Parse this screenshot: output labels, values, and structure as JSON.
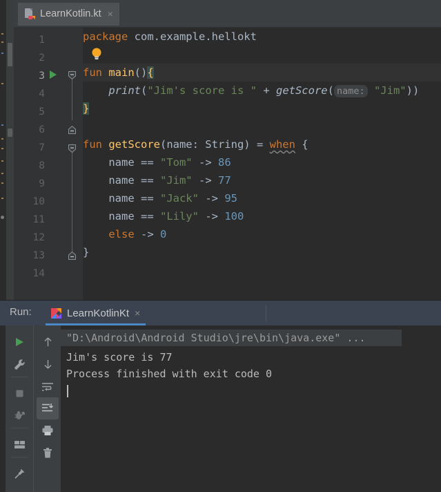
{
  "window": {
    "title": "LearnKotlin.kt",
    "theme": "darcula"
  },
  "colors": {
    "editor_bg": "#2b2b2b",
    "gutter_bg": "#313335",
    "tabbar_bg": "#3c3f41",
    "tab_active_bg": "#4e5254",
    "run_header_bg": "#3c4350",
    "run_tab_underline": "#4a88c7",
    "toolbar_bg": "#3c3f41",
    "keyword": "#cc7832",
    "function_name": "#ffc66d",
    "string": "#6a8759",
    "number": "#6897bb",
    "plain_text": "#a9b7c6",
    "line_number": "#606366",
    "run_arrow_green": "#499c54",
    "console_text": "#bbbbbb",
    "inlay_hint_bg": "#3d4144",
    "brace_match_bg": "#3b514d"
  },
  "editor_tabs": [
    {
      "label": "LearnKotlin.kt",
      "icon": "kotlin-file-icon",
      "close": "×",
      "active": true
    }
  ],
  "gutter": {
    "line_numbers": [
      "1",
      "2",
      "3",
      "4",
      "5",
      "6",
      "7",
      "8",
      "9",
      "10",
      "11",
      "12",
      "13",
      "14"
    ],
    "current_line": 3,
    "run_marker_line": 3,
    "bulb_line": 2,
    "fold_markers": [
      {
        "line": 3,
        "type": "fold-open"
      },
      {
        "line": 5,
        "type": "fold-end"
      },
      {
        "line": 7,
        "type": "fold-open"
      },
      {
        "line": 13,
        "type": "fold-end"
      }
    ]
  },
  "code": {
    "lines": [
      {
        "n": 1,
        "tokens": [
          {
            "t": "package ",
            "c": "kw"
          },
          {
            "t": "com.example.hellokt",
            "c": "pln"
          }
        ]
      },
      {
        "n": 2,
        "tokens": []
      },
      {
        "n": 3,
        "tokens": [
          {
            "t": "fun ",
            "c": "kw"
          },
          {
            "t": "main",
            "c": "fnm"
          },
          {
            "t": "()",
            "c": "pln"
          },
          {
            "t": "{",
            "c": "brace-hl"
          }
        ]
      },
      {
        "n": 4,
        "tokens": [
          {
            "t": "    ",
            "c": "pln"
          },
          {
            "t": "print",
            "c": "ital"
          },
          {
            "t": "(",
            "c": "pln"
          },
          {
            "t": "\"Jim's score is \"",
            "c": "str"
          },
          {
            "t": " + ",
            "c": "pln"
          },
          {
            "t": "getScore",
            "c": "ital"
          },
          {
            "t": "(",
            "c": "pln"
          },
          {
            "t": "name:",
            "c": "hint"
          },
          {
            "t": " ",
            "c": "pln"
          },
          {
            "t": "\"Jim\"",
            "c": "str"
          },
          {
            "t": "))",
            "c": "pln"
          }
        ]
      },
      {
        "n": 5,
        "tokens": [
          {
            "t": "}",
            "c": "brace-hl"
          }
        ]
      },
      {
        "n": 6,
        "tokens": []
      },
      {
        "n": 7,
        "tokens": [
          {
            "t": "fun ",
            "c": "kw"
          },
          {
            "t": "getScore",
            "c": "fnm"
          },
          {
            "t": "(name: String) = ",
            "c": "pln"
          },
          {
            "t": "when",
            "c": "kw wavy"
          },
          {
            "t": " {",
            "c": "pln"
          }
        ]
      },
      {
        "n": 8,
        "tokens": [
          {
            "t": "    name == ",
            "c": "pln"
          },
          {
            "t": "\"Tom\"",
            "c": "str"
          },
          {
            "t": " -> ",
            "c": "pln"
          },
          {
            "t": "86",
            "c": "num"
          }
        ]
      },
      {
        "n": 9,
        "tokens": [
          {
            "t": "    name == ",
            "c": "pln"
          },
          {
            "t": "\"Jim\"",
            "c": "str"
          },
          {
            "t": " -> ",
            "c": "pln"
          },
          {
            "t": "77",
            "c": "num"
          }
        ]
      },
      {
        "n": 10,
        "tokens": [
          {
            "t": "    name == ",
            "c": "pln"
          },
          {
            "t": "\"Jack\"",
            "c": "str"
          },
          {
            "t": " -> ",
            "c": "pln"
          },
          {
            "t": "95",
            "c": "num"
          }
        ]
      },
      {
        "n": 11,
        "tokens": [
          {
            "t": "    name == ",
            "c": "pln"
          },
          {
            "t": "\"Lily\"",
            "c": "str"
          },
          {
            "t": " -> ",
            "c": "pln"
          },
          {
            "t": "100",
            "c": "num"
          }
        ]
      },
      {
        "n": 12,
        "tokens": [
          {
            "t": "    ",
            "c": "pln"
          },
          {
            "t": "else",
            "c": "kw"
          },
          {
            "t": " -> ",
            "c": "pln"
          },
          {
            "t": "0",
            "c": "num"
          }
        ]
      },
      {
        "n": 13,
        "tokens": [
          {
            "t": "}",
            "c": "pln"
          }
        ]
      },
      {
        "n": 14,
        "tokens": []
      }
    ]
  },
  "run_window": {
    "label": "Run:",
    "tab": {
      "label": "LearnKotlinKt",
      "icon": "kotlin-logo-icon",
      "close": "×",
      "active": true
    },
    "toolbar_left": [
      {
        "name": "rerun-button",
        "icon": "play-icon",
        "active": false
      },
      {
        "name": "run-configuration-button",
        "icon": "wrench-icon",
        "active": false
      },
      {
        "name": "stop-button",
        "icon": "stop-square-icon",
        "active": false
      },
      {
        "name": "rerun-failed-tests-button",
        "icon": "debug-bug-icon",
        "active": false
      },
      {
        "name": "layout-settings-button",
        "icon": "panes-icon",
        "active": false
      },
      {
        "name": "pin-tab-button",
        "icon": "pin-icon",
        "active": false
      }
    ],
    "toolbar_right": [
      {
        "name": "previous-occurrence-button",
        "icon": "arrow-up-icon",
        "active": false
      },
      {
        "name": "next-occurrence-button",
        "icon": "arrow-down-icon",
        "active": false
      },
      {
        "name": "soft-wrap-button",
        "icon": "soft-wrap-icon",
        "active": false
      },
      {
        "name": "scroll-to-end-button",
        "icon": "scroll-to-end-icon",
        "active": true
      },
      {
        "name": "print-button",
        "icon": "printer-icon",
        "active": false
      },
      {
        "name": "clear-all-button",
        "icon": "trash-icon",
        "active": false
      }
    ],
    "console": {
      "command_line": "\"D:\\Android\\Android Studio\\jre\\bin\\java.exe\" ...",
      "output_lines": [
        "Jim's score is 77",
        "Process finished with exit code 0"
      ]
    }
  }
}
